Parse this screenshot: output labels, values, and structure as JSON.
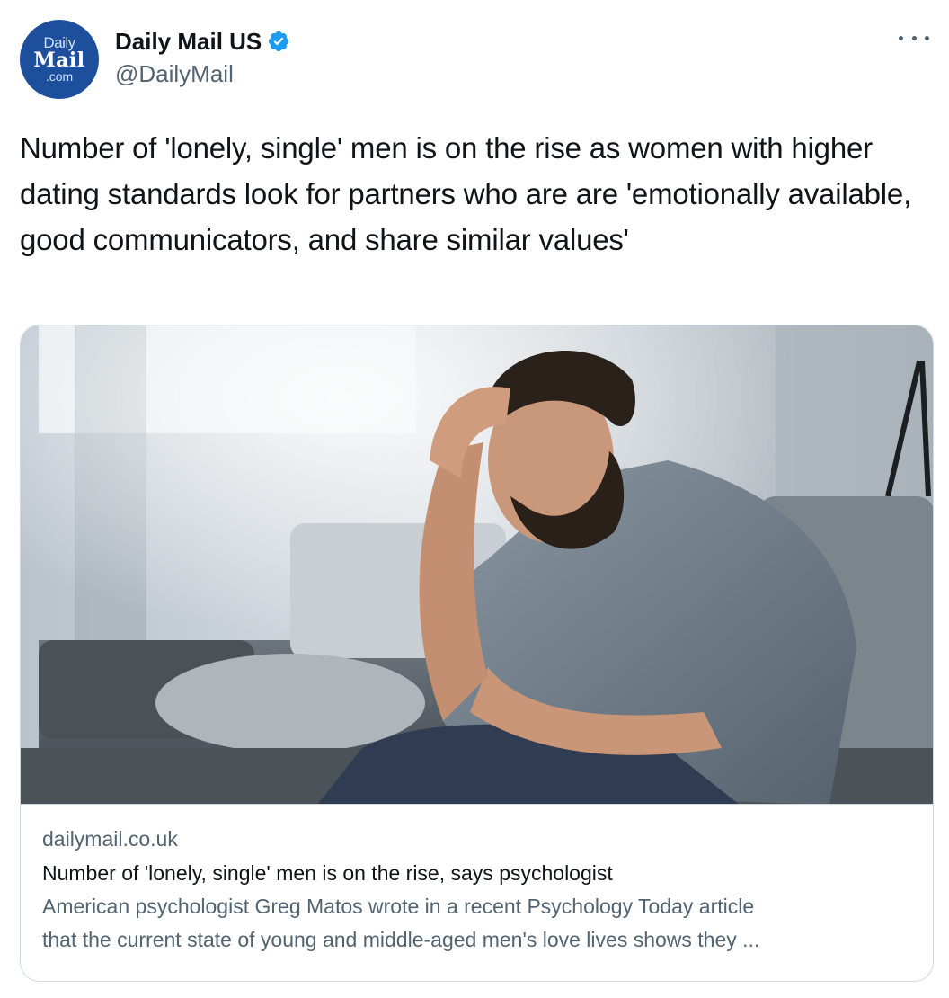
{
  "account": {
    "avatar_line1": "Daily",
    "avatar_line2": "Mail",
    "avatar_line3": ".com",
    "display_name": "Daily Mail US",
    "handle": "@DailyMail",
    "verified_icon": "verified-badge-icon"
  },
  "more_icon": "more-horizontal-icon",
  "tweet": {
    "text": "Number of 'lonely, single' men is on the rise as women with higher dating standards look for partners who are are 'emotionally available, good communicators, and share similar values'"
  },
  "card": {
    "domain": "dailymail.co.uk",
    "title": "Number of 'lonely, single' men is on the rise, says psychologist",
    "description_line1": "American psychologist Greg Matos wrote in a recent Psychology Today article",
    "description_line2": "that the current state of young and middle-aged men's love lives shows they ..."
  },
  "colors": {
    "text_primary": "#0f1419",
    "text_secondary": "#536471",
    "border": "#cfd9de",
    "verified_blue": "#1d9bf0",
    "avatar_blue": "#1d4f9c"
  }
}
